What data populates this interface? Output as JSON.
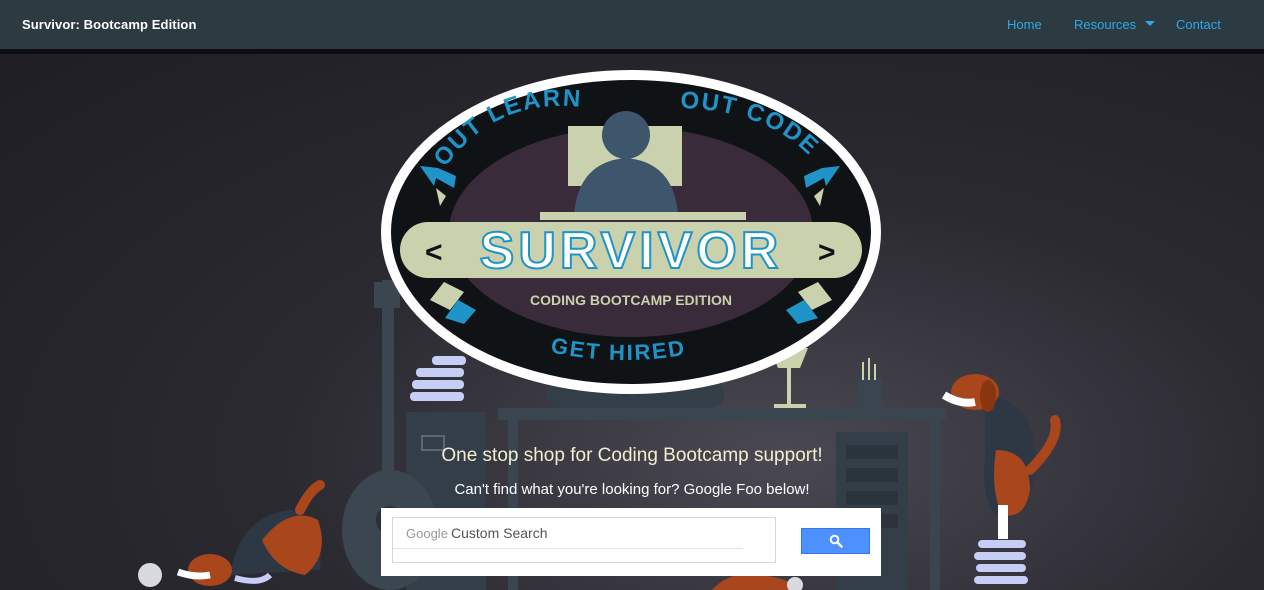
{
  "navbar": {
    "brand": "Survivor: Bootcamp Edition",
    "links": [
      {
        "label": "Home"
      },
      {
        "label": "Resources"
      },
      {
        "label": "Contact"
      }
    ]
  },
  "logo": {
    "arc_left": "OUT LEARN",
    "arc_right": "OUT CODE",
    "title": "SURVIVOR",
    "subtitle": "CODING BOOTCAMP EDITION",
    "bottom": "GET HIRED"
  },
  "hero": {
    "tagline": "One stop shop for Coding Bootcamp support!",
    "subtagline": "Can't find what you're looking for? Google Foo below!"
  },
  "search": {
    "brand": "Google",
    "placeholder": "Custom Search"
  },
  "colors": {
    "nav_bg": "#2c3a42",
    "link": "#2ea9e6",
    "logo_blue": "#1e94c8",
    "logo_cream": "#c9d2ad",
    "dog_orange": "#a9461c",
    "search_blue": "#4d90fe"
  }
}
